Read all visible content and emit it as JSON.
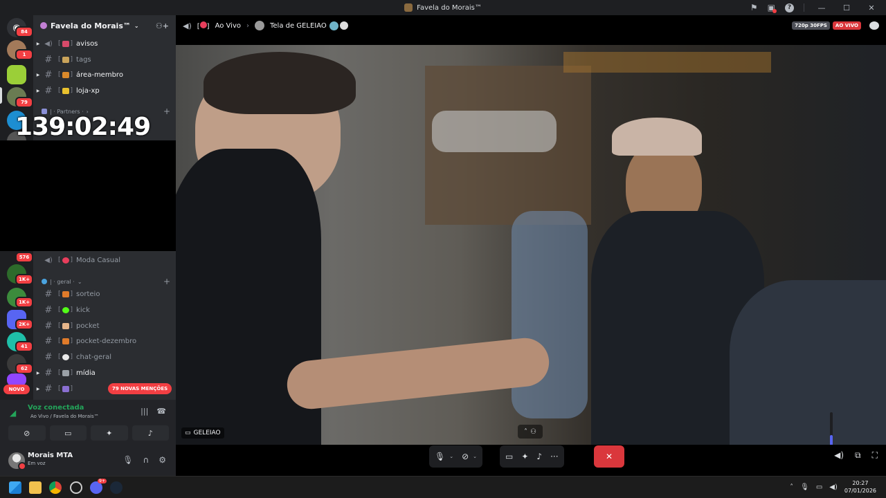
{
  "window": {
    "title": "Favela do Morais™"
  },
  "server": {
    "name": "Favela do Morais™"
  },
  "rail": {
    "badges": [
      "84",
      "1",
      "79",
      "576",
      "1K+",
      "1K+",
      "2K+",
      "41",
      "62"
    ],
    "novo_label": "NOVO"
  },
  "channels": {
    "top": [
      {
        "name": "avisos",
        "unread": true
      },
      {
        "name": "tags",
        "unread": false
      },
      {
        "name": "área-membro",
        "unread": true
      },
      {
        "name": "loja-xp",
        "unread": true
      }
    ],
    "partners_category": "| · Partners ·",
    "voice_channel": "Moda Casual",
    "geral_category": "| · geral ·",
    "geral": [
      {
        "name": "sorteio",
        "unread": false
      },
      {
        "name": "kick",
        "unread": false
      },
      {
        "name": "pocket",
        "unread": false
      },
      {
        "name": "pocket-dezembro",
        "unread": false
      },
      {
        "name": "chat-geral",
        "unread": false
      },
      {
        "name": "mídia",
        "unread": true
      }
    ],
    "mention_pill": "79 NOVAS MENÇÕES"
  },
  "overlay": {
    "timer": "139:02:49"
  },
  "voice": {
    "connected_label": "Voz conectada",
    "channel_path": "Ao Vivo / Favela do Morais™"
  },
  "user": {
    "name": "Morais MTA",
    "status": "Em voz"
  },
  "stream": {
    "channel": "Ao Vivo",
    "title": "Tela de GELEIAO",
    "quality": "720p 30FPS",
    "live": "AO VIVO",
    "streamer": "GELEIAO"
  },
  "volume": {
    "level_pct": 35
  },
  "taskbar": {
    "time": "20:27",
    "date": "07/01/2026",
    "steam_badge": "9+"
  }
}
